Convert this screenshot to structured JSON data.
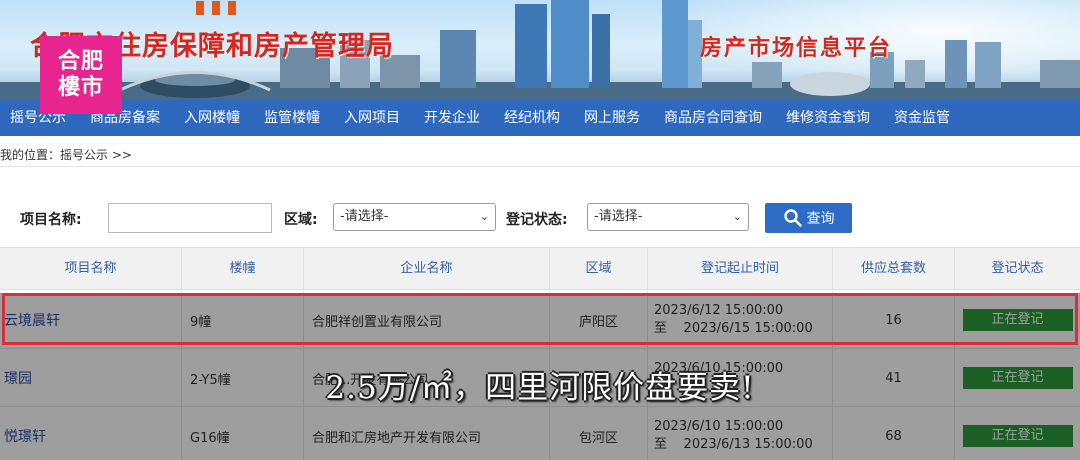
{
  "banner": {
    "title": "合肥市住房保障和房产管理局",
    "subtitle": "房产市场信息平台",
    "title_color": "#d8261d"
  },
  "logo": {
    "line1": "合肥",
    "line2": "樓市",
    "color": "#e8248f"
  },
  "nav": {
    "items": [
      "摇号公示",
      "商品房备案",
      "入网楼幢",
      "监管楼幢",
      "入网项目",
      "开发企业",
      "经纪机构",
      "网上服务",
      "商品房合同查询",
      "维修资金查询",
      "资金监管"
    ],
    "color": "#2f69bf"
  },
  "breadcrumb": "我的位置：摇号公示 >>",
  "search": {
    "project_label": "项目名称:",
    "project_value": "",
    "area_label": "区域:",
    "area_selected": "-请选择-",
    "status_label": "登记状态:",
    "status_selected": "-请选择-",
    "query_button": "查询",
    "button_color": "#2e6bc4"
  },
  "table": {
    "headers": [
      "项目名称",
      "楼幢",
      "企业名称",
      "区域",
      "登记起止时间",
      "供应总套数",
      "登记状态"
    ],
    "rows": [
      {
        "name": "云境晨轩",
        "building": "9幢",
        "company": "合肥祥创置业有限公司",
        "district": "庐阳区",
        "start": "2023/6/12 15:00:00",
        "end_prefix": "至",
        "end": "2023/6/15 15:00:00",
        "supply": "16",
        "status": "正在登记"
      },
      {
        "name": "璟园",
        "building": "2-Y5幢",
        "company": "合肥...开发有限公司",
        "district": "",
        "start": "2023/6/10 15:00:00",
        "end_prefix": "至",
        "end": "",
        "supply": "41",
        "status": "正在登记"
      },
      {
        "name": "悦璟轩",
        "building": "G16幢",
        "company": "合肥和汇房地产开发有限公司",
        "district": "包河区",
        "start": "2023/6/10 15:00:00",
        "end_prefix": "至",
        "end": "2023/6/13 15:00:00",
        "supply": "68",
        "status": "正在登记"
      }
    ],
    "status_color": "#2c9a3a",
    "highlight_color": "#d8303a"
  },
  "caption": "2.5万/㎡，四里河限价盘要卖!"
}
